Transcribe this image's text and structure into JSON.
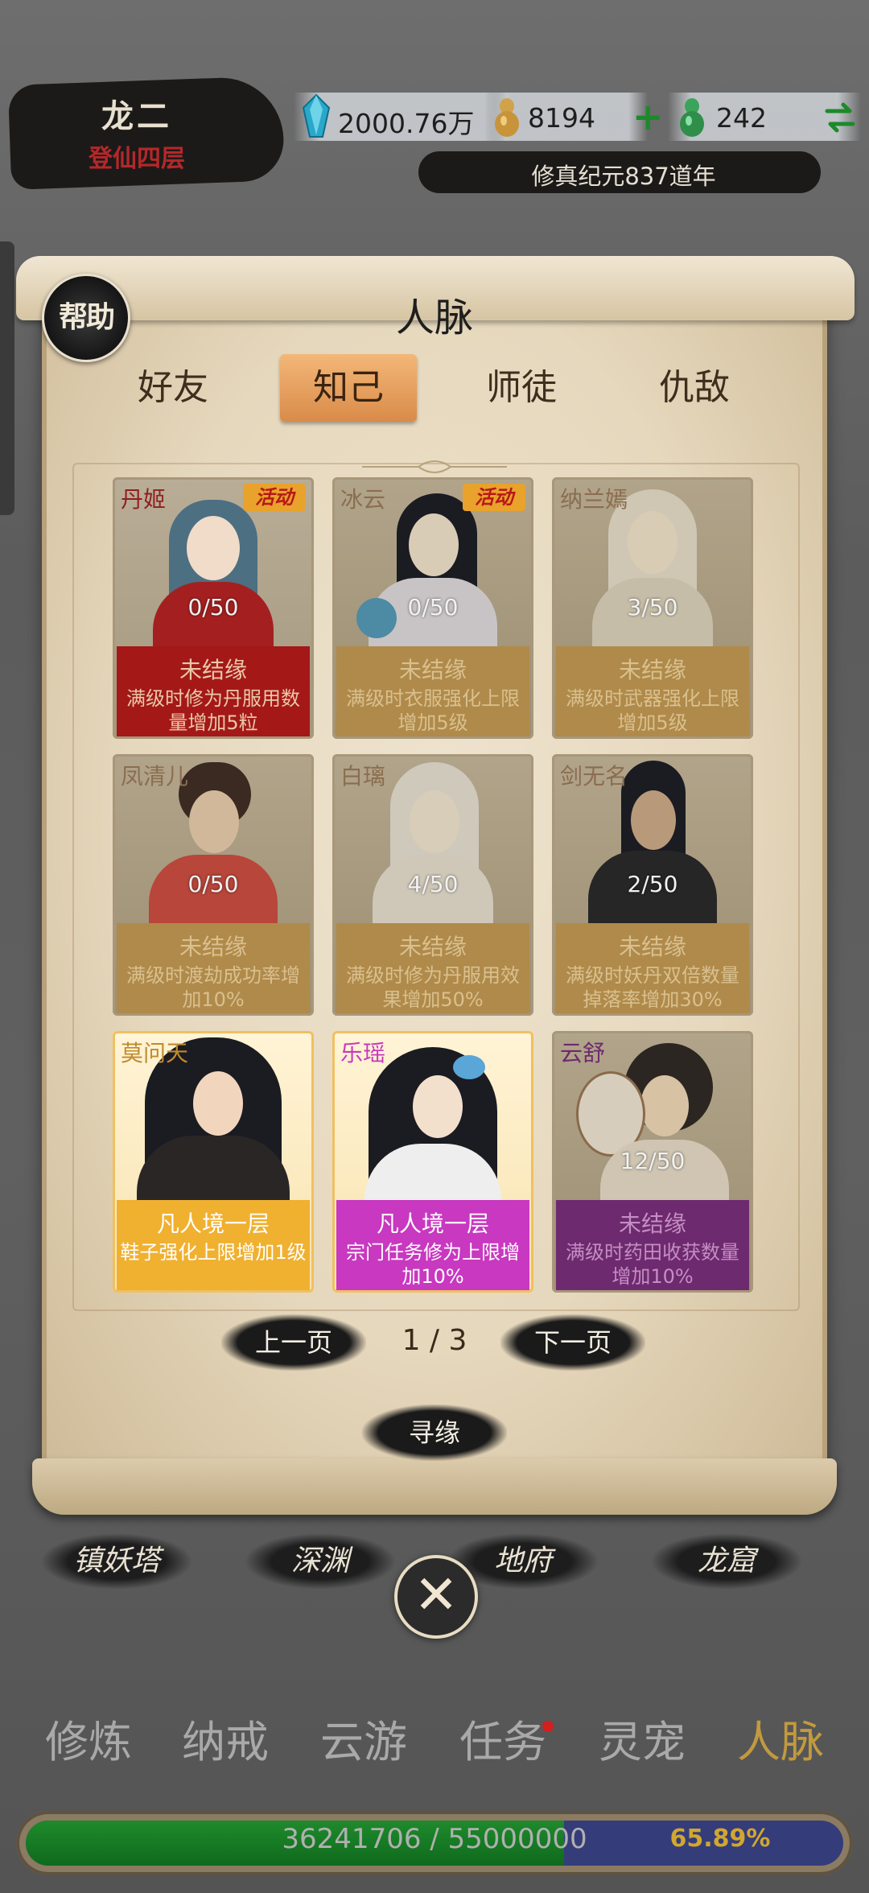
{
  "header": {
    "player_name": "龙二",
    "realm": "登仙四层",
    "spirit_stone": "2000.76万",
    "gold": "8194",
    "jade": "242",
    "era": "修真纪元837道年",
    "icons": [
      "blue-crystal-icon",
      "gold-gourd-icon",
      "plus-icon",
      "green-gourd-icon",
      "swap-icon"
    ]
  },
  "panel": {
    "help_label": "帮助",
    "title": "人脉",
    "tabs": [
      {
        "label": "好友",
        "active": false
      },
      {
        "label": "知己",
        "active": true
      },
      {
        "label": "师徒",
        "active": false
      },
      {
        "label": "仇敌",
        "active": false
      }
    ]
  },
  "cards": [
    {
      "name": "丹姬",
      "badge": "活动",
      "count": "0/50",
      "status": "未结缘",
      "desc": "满级时修为丹服用数量增加5粒",
      "theme": "red"
    },
    {
      "name": "冰云",
      "badge": "活动",
      "count": "0/50",
      "status": "未结缘",
      "desc": "满级时衣服强化上限增加5级",
      "theme": "locked"
    },
    {
      "name": "纳兰嫣",
      "badge": "",
      "count": "3/50",
      "status": "未结缘",
      "desc": "满级时武器强化上限增加5级",
      "theme": "locked"
    },
    {
      "name": "凤清儿",
      "badge": "",
      "count": "0/50",
      "status": "未结缘",
      "desc": "满级时渡劫成功率增加10%",
      "theme": "locked"
    },
    {
      "name": "白璃",
      "badge": "",
      "count": "4/50",
      "status": "未结缘",
      "desc": "满级时修为丹服用效果增加50%",
      "theme": "locked"
    },
    {
      "name": "剑无名",
      "badge": "",
      "count": "2/50",
      "status": "未结缘",
      "desc": "满级时妖丹双倍数量掉落率增加30%",
      "theme": "locked"
    },
    {
      "name": "莫问天",
      "badge": "",
      "count": "",
      "status": "凡人境一层",
      "desc": "鞋子强化上限增加1级",
      "theme": "gold"
    },
    {
      "name": "乐瑶",
      "badge": "",
      "count": "",
      "status": "凡人境一层",
      "desc": "宗门任务修为上限增加10%",
      "theme": "magenta"
    },
    {
      "name": "云舒",
      "badge": "",
      "count": "12/50",
      "status": "未结缘",
      "desc": "满级时药田收获数量增加10%",
      "theme": "purple"
    }
  ],
  "pager": {
    "prev": "上一页",
    "page": "1 / 3",
    "next": "下一页"
  },
  "seek_label": "寻缘",
  "regions": [
    "镇妖塔",
    "深渊",
    "地府",
    "龙窟"
  ],
  "nav": [
    {
      "label": "修炼",
      "active": false
    },
    {
      "label": "纳戒",
      "active": false
    },
    {
      "label": "云游",
      "active": false
    },
    {
      "label": "任务",
      "active": false,
      "dot": true
    },
    {
      "label": "灵宠",
      "active": false
    },
    {
      "label": "人脉",
      "active": true
    }
  ],
  "xp": {
    "text": "36241706 / 55000000",
    "percent": "65.89%",
    "fraction": 0.6589
  },
  "colors": {
    "accent_gold": "#c29a3e",
    "red_card": "#a41818",
    "gold_card": "#f0b030",
    "magenta_card": "#c838c0",
    "purple_card": "#6e2a6e"
  }
}
